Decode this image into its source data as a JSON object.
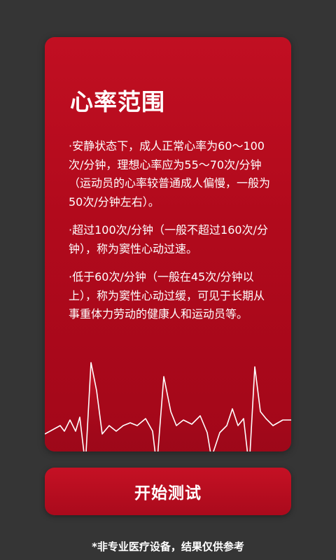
{
  "card": {
    "title": "心率范围",
    "paragraphs": [
      "·安静状态下，成人正常心率为60～100次/分钟，理想心率应为55～70次/分钟（运动员的心率较普通成人偏慢，一般为50次/分钟左右）。",
      "·超过100次/分钟（一般不超过160次/分钟），称为窦性心动过速。",
      "·低于60次/分钟（一般在45次/分钟以上），称为窦性心动过缓，可见于长期从事重体力劳动的健康人和运动员等。"
    ]
  },
  "button": {
    "label": "开始测试"
  },
  "footer": {
    "disclaimer": "*非专业医疗设备，结果仅供参考"
  },
  "colors": {
    "background": "#353535",
    "card_red": "#b80c1f",
    "text": "#ffffff"
  }
}
